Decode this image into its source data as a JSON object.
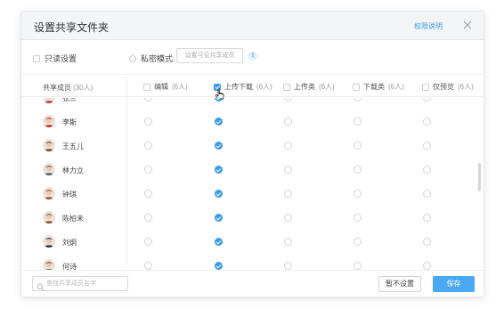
{
  "dialog": {
    "title": "设置共享文件夹",
    "help_link": "权限说明"
  },
  "options": {
    "readonly_label": "只读设置",
    "private_label": "私密模式",
    "set_members_button": "设置可见共享成员",
    "info_badge": "!"
  },
  "columns": {
    "members_label": "共享成员",
    "members_count": "(30人)",
    "permissions": [
      {
        "label": "编辑",
        "count": "(6人)",
        "checked": false
      },
      {
        "label": "上传下载",
        "count": "(6人)",
        "checked": true
      },
      {
        "label": "上传类",
        "count": "(6人)",
        "checked": false
      },
      {
        "label": "下载类",
        "count": "(6人)",
        "checked": false
      },
      {
        "label": "仅预览",
        "count": "(6人)",
        "checked": false
      }
    ]
  },
  "members": [
    {
      "name": "张三",
      "selected_column": 1,
      "avatar_color": "#b9423a"
    },
    {
      "name": "李斯",
      "selected_column": 1,
      "avatar_color": "#c0392b"
    },
    {
      "name": "王五儿",
      "selected_column": 1,
      "avatar_color": "#7a4a2e"
    },
    {
      "name": "林力立",
      "selected_column": 1,
      "avatar_color": "#5b6370"
    },
    {
      "name": "钟琪",
      "selected_column": 1,
      "avatar_color": "#a0522d"
    },
    {
      "name": "陈柏未",
      "selected_column": 1,
      "avatar_color": "#8b5a2b"
    },
    {
      "name": "刘炯",
      "selected_column": 1,
      "avatar_color": "#2f3a45"
    },
    {
      "name": "何诗",
      "selected_column": 1,
      "avatar_color": "#6d4c41"
    }
  ],
  "footer": {
    "search_placeholder": "查找共享成员名字",
    "cancel_button": "暂不设置",
    "save_button": "保存"
  },
  "colors": {
    "accent": "#3a9bf0",
    "save_button": "#4aa8f5"
  }
}
